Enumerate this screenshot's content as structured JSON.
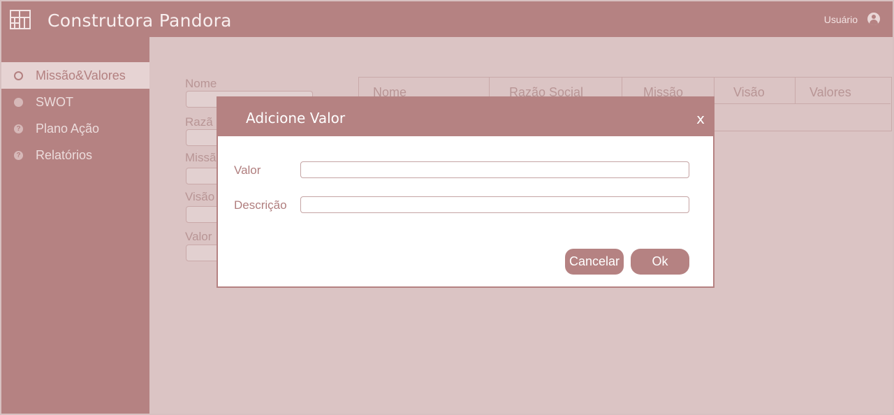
{
  "header": {
    "app_title": "Construtora Pandora",
    "user_label": "Usuário",
    "logo_icon": "building-grid-icon",
    "user_icon": "user-avatar-icon"
  },
  "sidebar": {
    "items": [
      {
        "label": "Missão&Valores",
        "icon": "target-icon",
        "active": true
      },
      {
        "label": "SWOT",
        "icon": "chart-icon",
        "active": false
      },
      {
        "label": "Plano Ação",
        "icon": "question-icon",
        "active": false
      },
      {
        "label": "Relatórios",
        "icon": "question-icon",
        "active": false
      }
    ]
  },
  "form": {
    "labels": [
      "Nome",
      "Razã",
      "Missã",
      "Visão",
      "Valor"
    ]
  },
  "grid": {
    "columns": [
      "Nome",
      "Razão Social",
      "Missão",
      "Visão",
      "Valores"
    ]
  },
  "modal": {
    "title": "Adicione Valor",
    "close_label": "x",
    "fields": [
      {
        "label": "Valor",
        "value": ""
      },
      {
        "label": "Descrição",
        "value": ""
      }
    ],
    "cancel_label": "Cancelar",
    "ok_label": "Ok"
  },
  "colors": {
    "primary": "#b58282",
    "background": "#dbc4c4",
    "sidebar_active": "#e6d3d3"
  }
}
